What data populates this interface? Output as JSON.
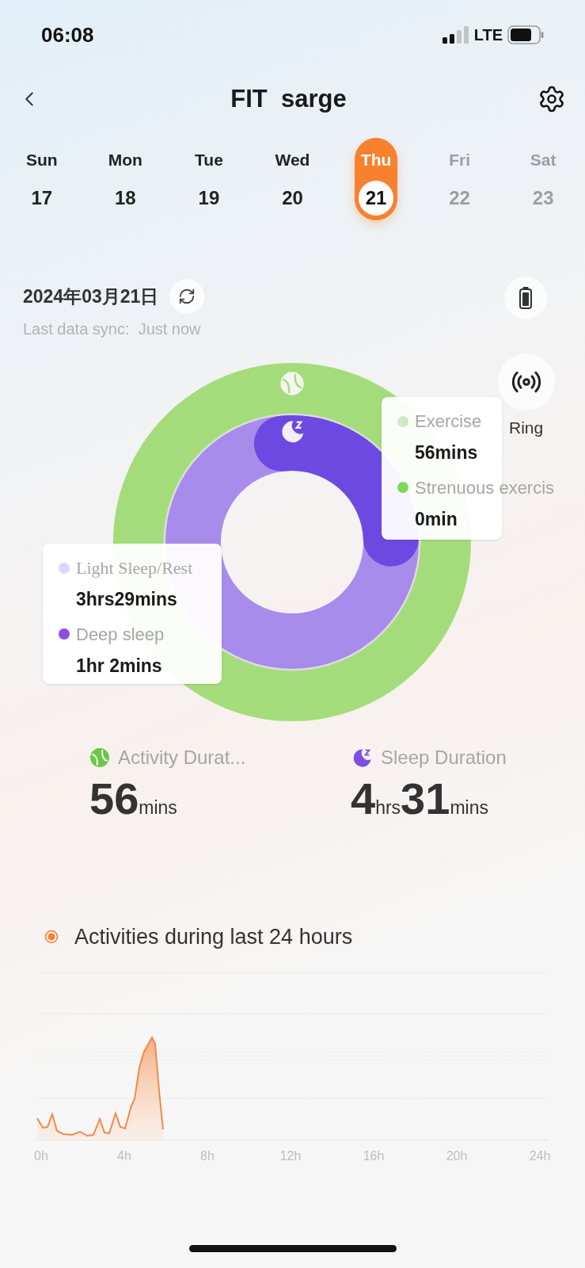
{
  "status_bar": {
    "time": "06:08",
    "network": "LTE"
  },
  "header": {
    "title": "FIT  sarge"
  },
  "week": [
    {
      "day": "Sun",
      "date": "17",
      "selected": false,
      "disabled": false
    },
    {
      "day": "Mon",
      "date": "18",
      "selected": false,
      "disabled": false
    },
    {
      "day": "Tue",
      "date": "19",
      "selected": false,
      "disabled": false
    },
    {
      "day": "Wed",
      "date": "20",
      "selected": false,
      "disabled": false
    },
    {
      "day": "Thu",
      "date": "21",
      "selected": true,
      "disabled": false
    },
    {
      "day": "Fri",
      "date": "22",
      "selected": false,
      "disabled": true
    },
    {
      "day": "Sat",
      "date": "23",
      "selected": false,
      "disabled": true
    }
  ],
  "summary": {
    "date": "2024年03月21日",
    "sync_text": "Last data sync:  Just now",
    "ring_label": "Ring"
  },
  "exercise_tooltip": [
    {
      "label": "Exercise",
      "value": "56mins",
      "color": "#cdebc6"
    },
    {
      "label": "Strenuous exercis",
      "value": "0min",
      "color": "#7ed957"
    }
  ],
  "sleep_tooltip": [
    {
      "label": "Light Sleep/Rest",
      "value": "3hrs29mins",
      "color": "#ddd6fb"
    },
    {
      "label": "Deep sleep",
      "value": "1hr 2mins",
      "color": "#8f4ee0"
    }
  ],
  "stats": [
    {
      "kind": "activity",
      "label": "Activity Durat...",
      "parts": [
        {
          "value": "56",
          "unit": "mins"
        }
      ]
    },
    {
      "kind": "sleep",
      "label": "Sleep Duration",
      "parts": [
        {
          "value": "4",
          "unit": "hrs"
        },
        {
          "value": "31",
          "unit": "mins"
        }
      ]
    }
  ],
  "activities": {
    "title": "Activities during last 24 hours",
    "x_labels": [
      "0h",
      "4h",
      "8h",
      "12h",
      "16h",
      "20h",
      "24h"
    ]
  }
}
